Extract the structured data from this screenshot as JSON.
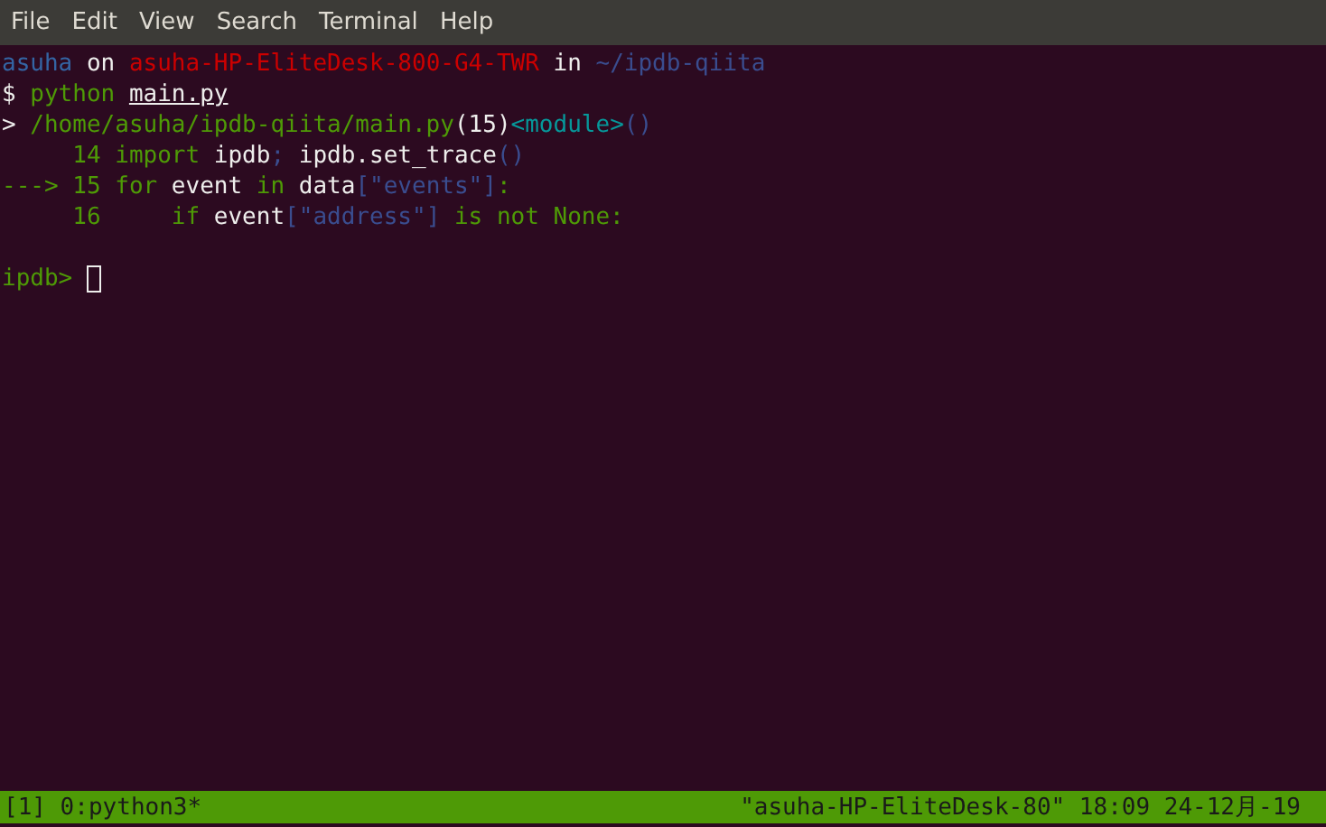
{
  "menu": [
    "File",
    "Edit",
    "View",
    "Search",
    "Terminal",
    "Help"
  ],
  "lines": [
    [
      {
        "kind": "user",
        "text": "asuha"
      },
      {
        "kind": "plain",
        "text": " on "
      },
      {
        "kind": "host",
        "text": "asuha-HP-EliteDesk-800-G4-TWR"
      },
      {
        "kind": "plain",
        "text": " in "
      },
      {
        "kind": "path",
        "text": "~/ipdb-qiita"
      }
    ],
    [
      {
        "kind": "plain",
        "text": "$ "
      },
      {
        "kind": "green",
        "text": "python "
      },
      {
        "kind": "underline",
        "text": "main.py"
      }
    ],
    [
      {
        "kind": "plain",
        "text": "> "
      },
      {
        "kind": "green",
        "text": "/home/asuha/ipdb-qiita/main.py"
      },
      {
        "kind": "plain",
        "text": "(15)"
      },
      {
        "kind": "cyan",
        "text": "<module>"
      },
      {
        "kind": "path",
        "text": "()"
      }
    ],
    [
      {
        "kind": "green",
        "text": "     14 import "
      },
      {
        "kind": "plain",
        "text": "ipdb"
      },
      {
        "kind": "path",
        "text": "; "
      },
      {
        "kind": "plain",
        "text": "ipdb.set_trace"
      },
      {
        "kind": "path",
        "text": "()"
      }
    ],
    [
      {
        "kind": "green",
        "text": "---> 15 for "
      },
      {
        "kind": "plain",
        "text": "event "
      },
      {
        "kind": "green",
        "text": "in "
      },
      {
        "kind": "plain",
        "text": "data"
      },
      {
        "kind": "path",
        "text": "[\"events\"]"
      },
      {
        "kind": "green",
        "text": ":"
      }
    ],
    [
      {
        "kind": "green",
        "text": "     16     if "
      },
      {
        "kind": "plain",
        "text": "event"
      },
      {
        "kind": "path",
        "text": "[\"address\"]"
      },
      {
        "kind": "green",
        "text": " is not None:"
      }
    ]
  ],
  "prompt": "ipdb>",
  "status": {
    "left": "[1] 0:python3*",
    "right": "\"asuha-HP-EliteDesk-80\" 18:09 24-12月-19"
  }
}
